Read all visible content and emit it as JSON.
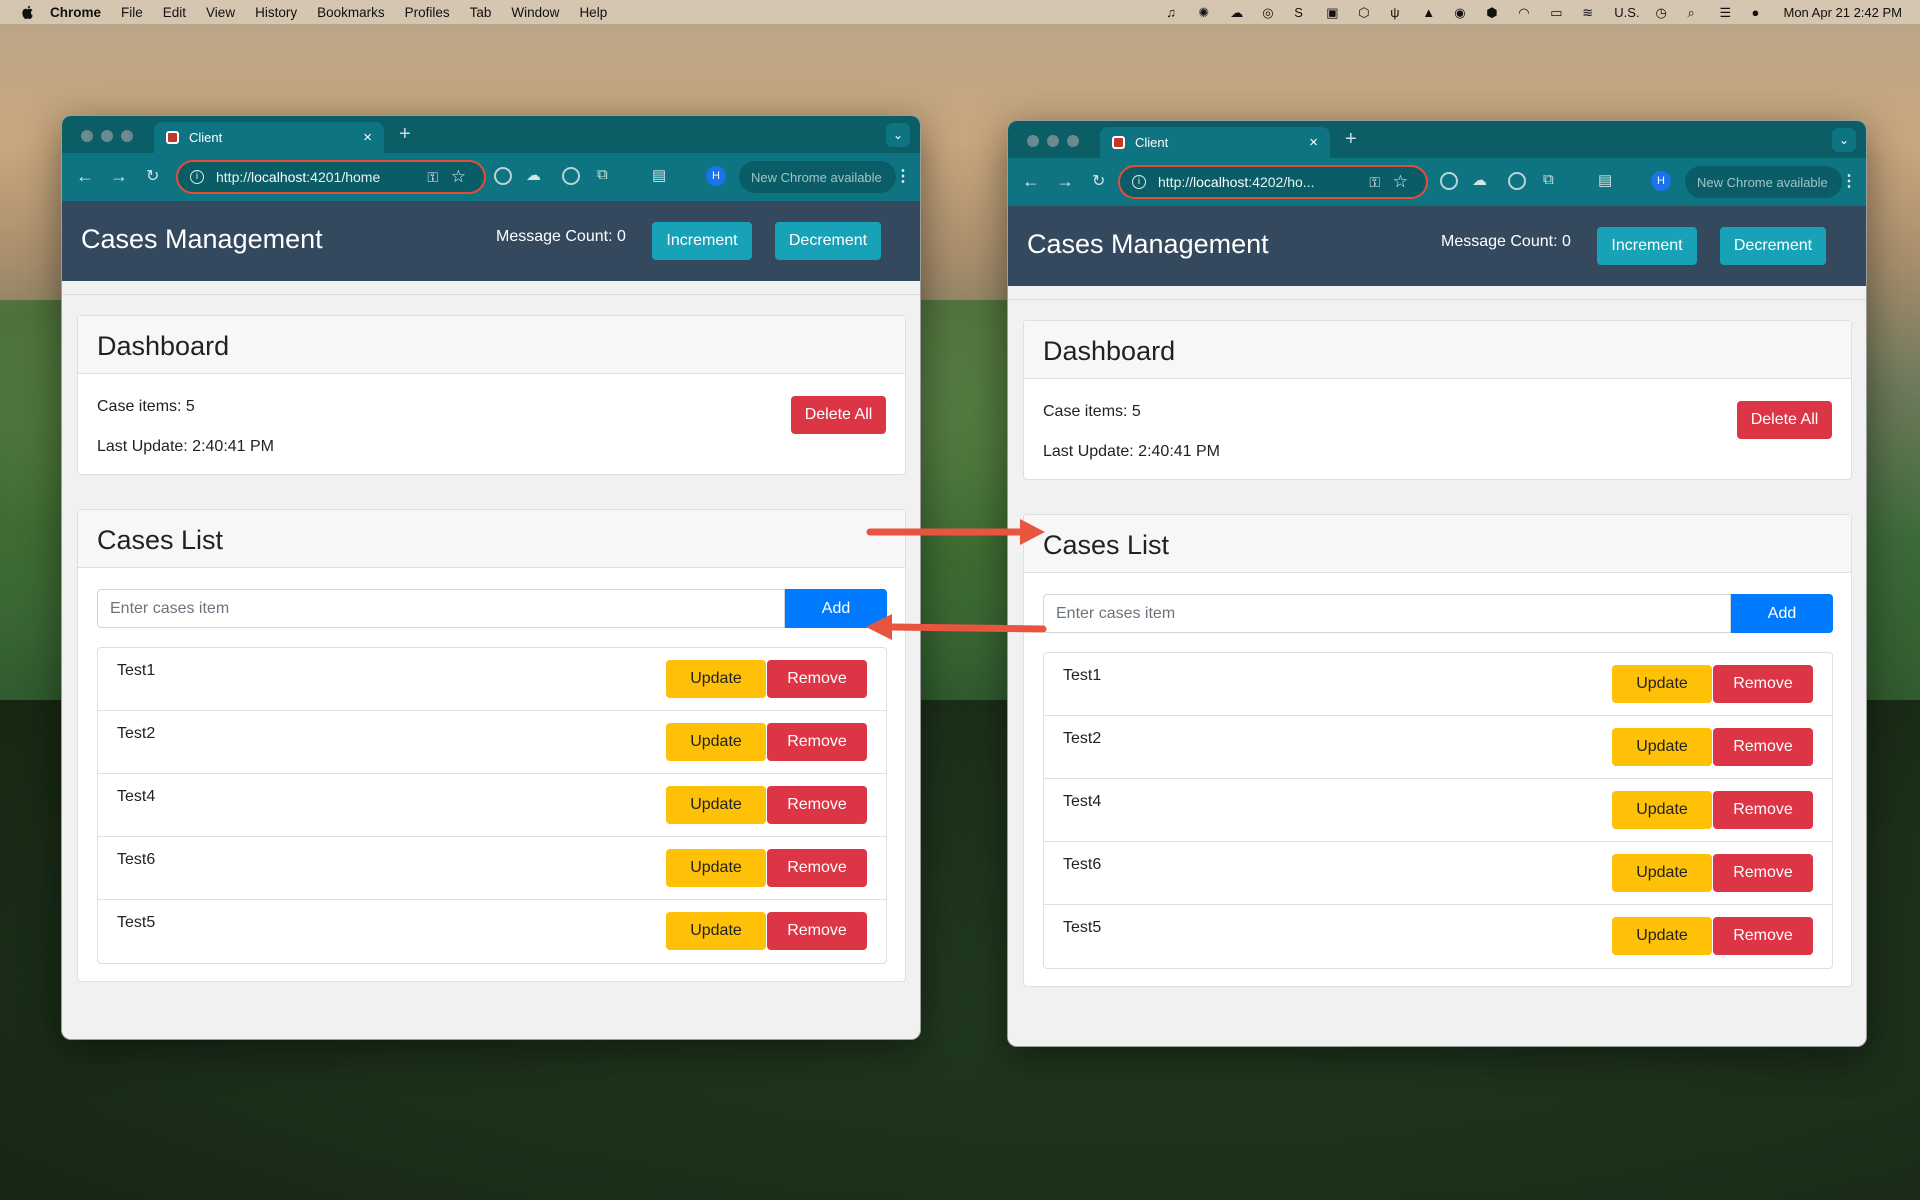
{
  "menubar": {
    "app": "Chrome",
    "items": [
      "File",
      "Edit",
      "View",
      "History",
      "Bookmarks",
      "Profiles",
      "Tab",
      "Window",
      "Help"
    ],
    "input_source": "U.S.",
    "datetime": "Mon Apr 21  2:42 PM"
  },
  "windows": [
    {
      "tab_title": "Client",
      "url_prefix": "http://",
      "url_host": "localhost",
      "url_rest": ":4201/home",
      "update_chip": "New Chrome available",
      "avatar": "H",
      "brand": "Cases Management",
      "message_count": "Message Count: 0",
      "increment": "Increment",
      "decrement": "Decrement",
      "dashboard_title": "Dashboard",
      "case_items": "Case items: 5",
      "last_update": "Last Update: 2:40:41 PM",
      "delete_all": "Delete All",
      "list_title": "Cases List",
      "input_placeholder": "Enter cases item",
      "add": "Add",
      "items": [
        {
          "name": "Test1",
          "update": "Update",
          "remove": "Remove"
        },
        {
          "name": "Test2",
          "update": "Update",
          "remove": "Remove"
        },
        {
          "name": "Test4",
          "update": "Update",
          "remove": "Remove"
        },
        {
          "name": "Test6",
          "update": "Update",
          "remove": "Remove"
        },
        {
          "name": "Test5",
          "update": "Update",
          "remove": "Remove"
        }
      ]
    },
    {
      "tab_title": "Client",
      "url_prefix": "http://",
      "url_host": "localhost",
      "url_rest": ":4202/ho...",
      "update_chip": "New Chrome available",
      "avatar": "H",
      "brand": "Cases Management",
      "message_count": "Message Count: 0",
      "increment": "Increment",
      "decrement": "Decrement",
      "dashboard_title": "Dashboard",
      "case_items": "Case items: 5",
      "last_update": "Last Update: 2:40:41 PM",
      "delete_all": "Delete All",
      "list_title": "Cases List",
      "input_placeholder": "Enter cases item",
      "add": "Add",
      "items": [
        {
          "name": "Test1",
          "update": "Update",
          "remove": "Remove"
        },
        {
          "name": "Test2",
          "update": "Update",
          "remove": "Remove"
        },
        {
          "name": "Test4",
          "update": "Update",
          "remove": "Remove"
        },
        {
          "name": "Test6",
          "update": "Update",
          "remove": "Remove"
        },
        {
          "name": "Test5",
          "update": "Update",
          "remove": "Remove"
        }
      ]
    }
  ],
  "colors": {
    "tab_strip": "#0b5d66",
    "toolbar": "#0e7481",
    "navbar": "#34495e",
    "info": "#17a2b8",
    "danger": "#dc3545",
    "primary": "#007bff",
    "warning": "#ffc107",
    "annotation_arrow": "#e8543f"
  }
}
